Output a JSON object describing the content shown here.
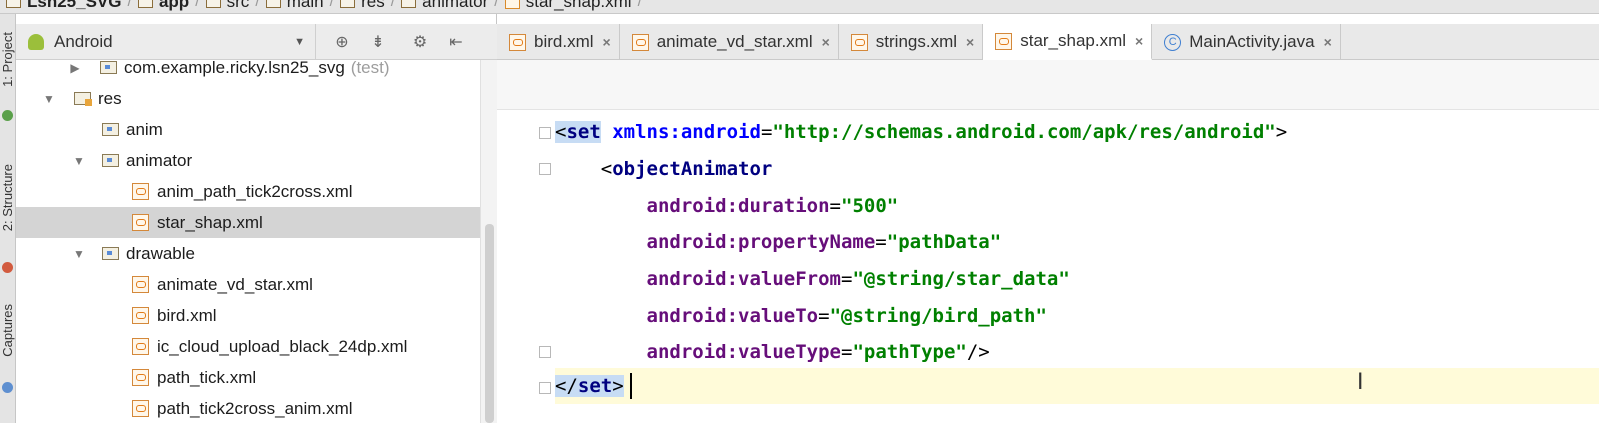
{
  "breadcrumb": [
    {
      "label": "Lsn25_SVG",
      "icon": "folder-icon"
    },
    {
      "label": "app",
      "icon": "module-folder-icon"
    },
    {
      "label": "src",
      "icon": "folder-icon"
    },
    {
      "label": "main",
      "icon": "folder-icon"
    },
    {
      "label": "res",
      "icon": "resource-folder-icon"
    },
    {
      "label": "animator",
      "icon": "package-folder-icon"
    },
    {
      "label": "star_shap.xml",
      "icon": "xml-file-icon"
    }
  ],
  "side_strip": {
    "project_label": "1: Project",
    "structure_label": "2: Structure",
    "captures_label": "Captures"
  },
  "project_panel": {
    "view_selector": "Android",
    "tree": [
      {
        "label": "com.example.ricky.lsn25_svg",
        "suffix": "(test)",
        "kind": "package",
        "arrow": "▶"
      },
      {
        "label": "res",
        "kind": "res",
        "arrow": "▼"
      },
      {
        "label": "anim",
        "kind": "pkg",
        "arrow": ""
      },
      {
        "label": "animator",
        "kind": "pkg",
        "arrow": "▼"
      },
      {
        "label": "anim_path_tick2cross.xml",
        "kind": "xml",
        "arrow": ""
      },
      {
        "label": "star_shap.xml",
        "kind": "xml",
        "arrow": "",
        "selected": true
      },
      {
        "label": "drawable",
        "kind": "pkg",
        "arrow": "▼"
      },
      {
        "label": "animate_vd_star.xml",
        "kind": "xml",
        "arrow": ""
      },
      {
        "label": "bird.xml",
        "kind": "xml",
        "arrow": ""
      },
      {
        "label": "ic_cloud_upload_black_24dp.xml",
        "kind": "xml",
        "arrow": ""
      },
      {
        "label": "path_tick.xml",
        "kind": "xml",
        "arrow": ""
      },
      {
        "label": "path_tick2cross_anim.xml",
        "kind": "xml",
        "arrow": ""
      }
    ]
  },
  "editor": {
    "tabs": [
      {
        "label": "bird.xml",
        "icon": "xml-file-icon",
        "active": false
      },
      {
        "label": "animate_vd_star.xml",
        "icon": "xml-file-icon",
        "active": false
      },
      {
        "label": "strings.xml",
        "icon": "xml-file-icon",
        "active": false
      },
      {
        "label": "star_shap.xml",
        "icon": "xml-file-icon",
        "active": true
      },
      {
        "label": "MainActivity.java",
        "icon": "java-class-icon",
        "active": false
      }
    ],
    "close_glyph": "×",
    "code": {
      "l1": {
        "open": "<",
        "tag": "set",
        "attr": "xmlns:android",
        "eq": "=",
        "value": "\"http://schemas.android.com/apk/res/android\"",
        "close": ">"
      },
      "l2": {
        "open": "<",
        "tag": "objectAnimator"
      },
      "l3": {
        "attr": "android:duration",
        "eq": "=",
        "value": "\"500\""
      },
      "l4": {
        "attr": "android:propertyName",
        "eq": "=",
        "value": "\"pathData\""
      },
      "l5": {
        "attr": "android:valueFrom",
        "eq": "=",
        "value": "\"@string/star_data\""
      },
      "l6": {
        "attr": "android:valueTo",
        "eq": "=",
        "value": "\"@string/bird_path\""
      },
      "l7": {
        "attr": "android:valueType",
        "eq": "=",
        "value": "\"pathType\"",
        "close": "/>"
      },
      "l8": {
        "open": "</",
        "tag": "set",
        "close": ">"
      }
    }
  }
}
